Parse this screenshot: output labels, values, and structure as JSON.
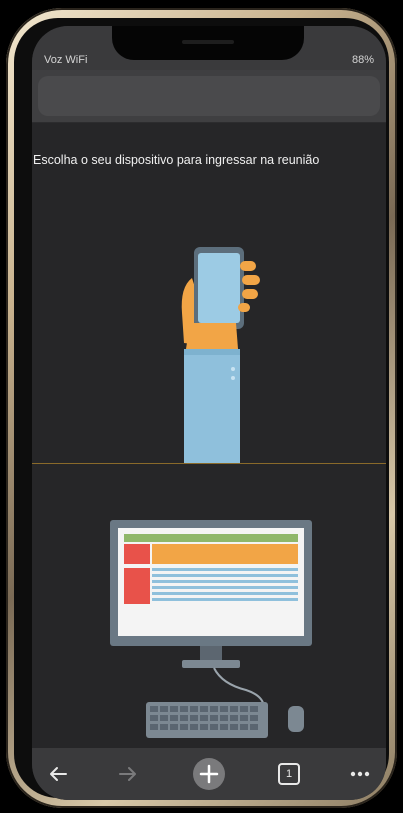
{
  "status_bar": {
    "carrier": "Voz WiFi",
    "battery": "88%"
  },
  "prompt": "Escolha o seu dispositivo para ingressar na reunião",
  "options": [
    {
      "device": "mobile",
      "icon": "hand-holding-phone-icon"
    },
    {
      "device": "desktop",
      "icon": "desktop-computer-icon"
    }
  ],
  "toolbar": {
    "tab_count": "1",
    "icons": [
      "back-arrow-icon",
      "forward-arrow-icon",
      "new-tab-plus-icon",
      "tabs-icon",
      "more-icon"
    ]
  },
  "colors": {
    "screen_bg": "#262628",
    "accent_divider": "#8a6a2a",
    "phone_blue": "#8fc0dc",
    "hand_orange": "#f2a546"
  }
}
